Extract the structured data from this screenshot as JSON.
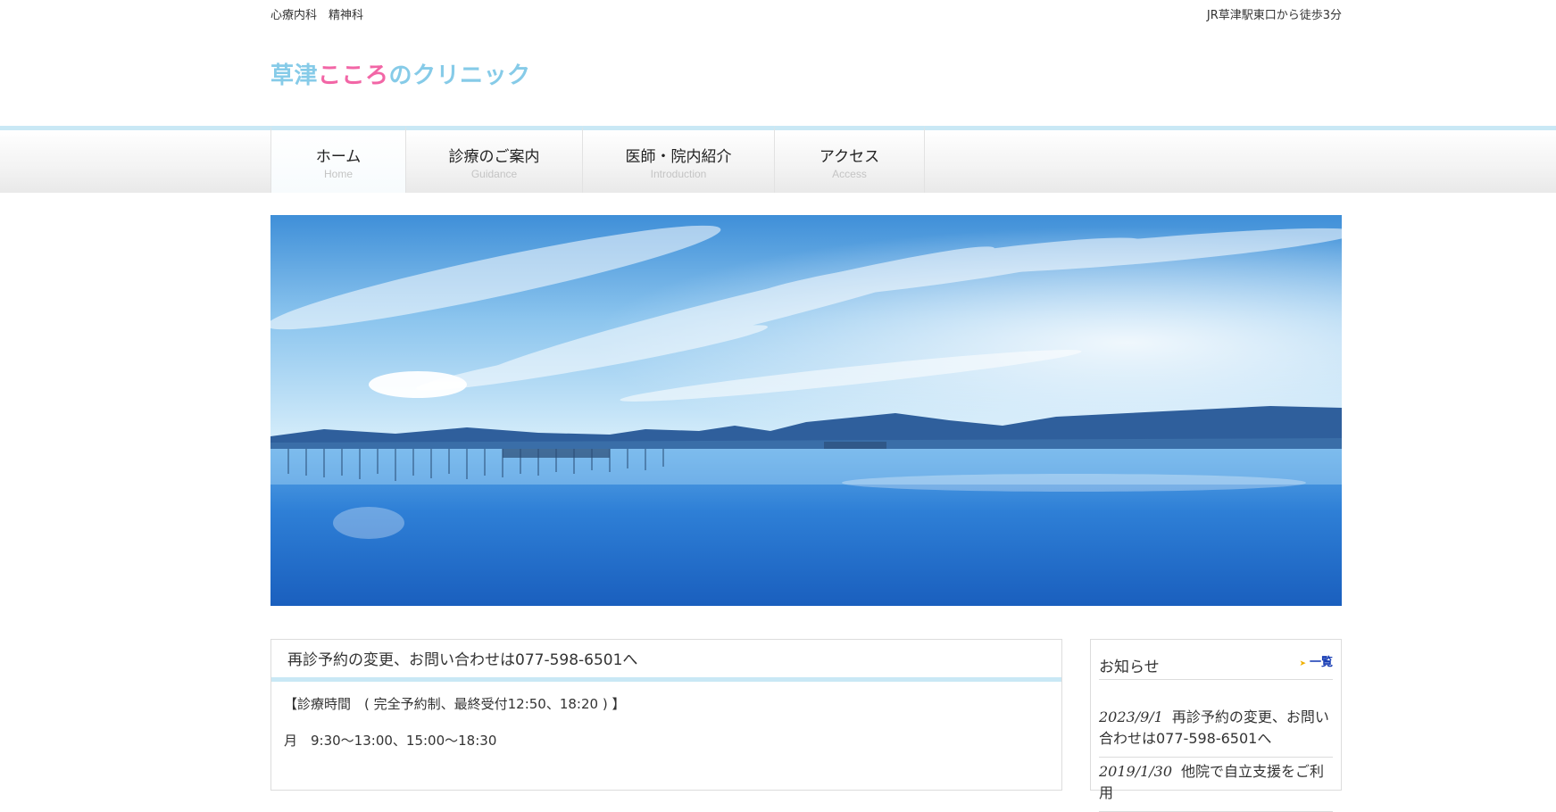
{
  "topbar": {
    "left_text": "心療内科　精神科",
    "right_text": "JR草津駅東口から徒歩3分"
  },
  "logo": {
    "part1": "草津",
    "part2": "こころ",
    "part3": "のクリニック",
    "colors": {
      "blue": "#86cbe8",
      "pink": "#f266a6"
    }
  },
  "nav": {
    "items": [
      {
        "jp": "ホーム",
        "en": "Home"
      },
      {
        "jp": "診療のご案内",
        "en": "Guidance"
      },
      {
        "jp": "医師・院内紹介",
        "en": "Introduction"
      },
      {
        "jp": "アクセス",
        "en": "Access"
      }
    ],
    "accent_color": "#c9e8f5"
  },
  "main": {
    "heading": "再診予約の変更、お問い合わせは077-598-6501へ",
    "lines": [
      "【診療時間　( 完全予約制、最終受付12:50、18:20 ) 】",
      "月　9:30〜13:00、15:00〜18:30"
    ]
  },
  "sidebar": {
    "title": "お知らせ",
    "more_label": "一覧",
    "news": [
      {
        "date": "2023/9/1",
        "text": "再診予約の変更、お問い合わせは077-598-6501へ"
      },
      {
        "date": "2019/1/30",
        "text": "他院で自立支援をご利用"
      }
    ]
  }
}
